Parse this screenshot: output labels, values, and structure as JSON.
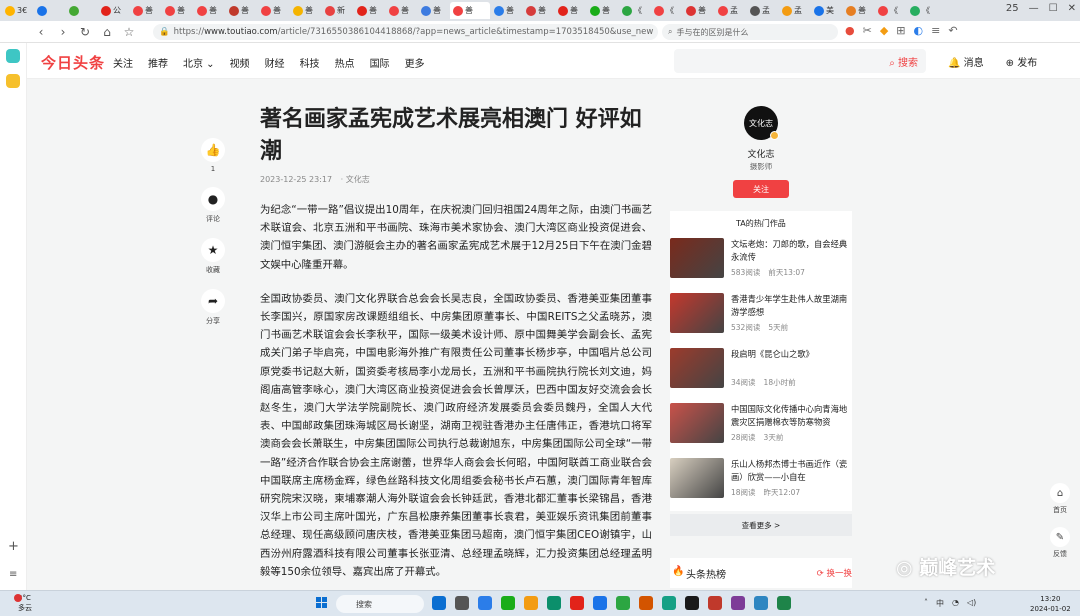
{
  "browser": {
    "tabs": [
      {
        "label": "3€",
        "color": "#ffb400"
      },
      {
        "label": "",
        "color": "#1a73e8"
      },
      {
        "label": "",
        "color": "#44a833"
      },
      {
        "label": "公",
        "color": "#e2231a"
      },
      {
        "label": "善",
        "color": "#f04142"
      },
      {
        "label": "善",
        "color": "#f04142"
      },
      {
        "label": "善",
        "color": "#f04142"
      },
      {
        "label": "善",
        "color": "#c0392b"
      },
      {
        "label": "善",
        "color": "#f04142"
      },
      {
        "label": "善",
        "color": "#f5b400"
      },
      {
        "label": "新",
        "color": "#e84141"
      },
      {
        "label": "善",
        "color": "#e2231a"
      },
      {
        "label": "善",
        "color": "#f04142"
      },
      {
        "label": "善",
        "color": "#3d7be0"
      },
      {
        "label": "善",
        "color": "#f04142",
        "active": true
      },
      {
        "label": "善",
        "color": "#2b7de9"
      },
      {
        "label": "善",
        "color": "#d63b3b"
      },
      {
        "label": "善",
        "color": "#e2231a"
      },
      {
        "label": "善",
        "color": "#1aad19"
      },
      {
        "label": "《",
        "color": "#2ca642"
      },
      {
        "label": "《",
        "color": "#f04142"
      },
      {
        "label": "善",
        "color": "#d33"
      },
      {
        "label": "孟",
        "color": "#f04142"
      },
      {
        "label": "孟",
        "color": "#555"
      },
      {
        "label": "孟",
        "color": "#f39c12"
      },
      {
        "label": "美",
        "color": "#1a73e8"
      },
      {
        "label": "善",
        "color": "#e67e22"
      },
      {
        "label": "《",
        "color": "#f04142"
      },
      {
        "label": "《",
        "color": "#27ae60"
      }
    ],
    "tab_count": "25",
    "url_host": "www.toutiao.com",
    "url_path": "/article/7316550386104418868/?app=news_article&timestamp=1703518450&use_new",
    "search_placeholder": "手与在的区别是什么"
  },
  "site": {
    "logo": "今日头条",
    "nav": [
      "关注",
      "推荐",
      "北京 ⌄",
      "视频",
      "财经",
      "科技",
      "热点",
      "国际",
      "更多"
    ],
    "search_button": "搜索",
    "messages": "消息",
    "publish": "发布"
  },
  "actions": {
    "like_count": "1",
    "comment": "评论",
    "favorite": "收藏",
    "share": "分享"
  },
  "article": {
    "title": "著名画家孟宪成艺术展亮相澳门 好评如潮",
    "date": "2023-12-25 23:17",
    "source": "· 文化志",
    "paragraphs": [
      "为纪念“一带一路”倡议提出10周年，在庆祝澳门回归祖国24周年之际，由澳门书画艺术联谊会、北京五洲和平书画院、珠海市美术家协会、澳门大湾区商业投资促进会、澳门恒宇集团、澳门游艇会主办的著名画家孟宪成艺术展于12月25日下午在澳门金碧文娱中心隆重开幕。",
      "全国政协委员、澳门文化界联合总会会长吴志良，全国政协委员、香港美亚集团董事长李国兴，原国家房改课题组组长、中房集团原董事长、中国REITS之父孟晓苏，澳门书画艺术联谊会会长李秋平，国际一级美术设计师、原中国舞美学会副会长、孟宪成关门弟子毕启亮，中国电影海外推广有限责任公司董事长杨步亭，中国唱片总公司原党委书记赵大新，国资委考核局李小龙局长，五洲和平书画院执行院长刘文迪，妈阁庙高管李咏心，澳门大湾区商业投资促进会会长曾厚沃，巴西中国友好交流会会长赵冬生，澳门大学法学院副院长、澳门政府经济发展委员会委员魏丹，全国人大代表、中国邮政集团珠海城区局长谢坚，湖南卫视驻香港办主任唐伟正，香港坑口将军澳商会会长萧联生，中房集团国际公司执行总裁谢旭东，中房集团国际公司全球“一带一路”经济合作联合协会主席谢蕾，世界华人商会会长何昭，中国阿联酋工商业联合会中国联席主席杨金辉，绿色丝路科技文化周组委会秘书长卢石蕙，澳门国际青年智库研究院宋汉晓，柬埔寨潮人海外联谊会会长钟廷武，香港北都汇董事长梁锦昌，香港汉华上市公司主席叶国光，广东昌松康养集团董事长袁君，美亚娱乐资讯集团前董事总经理、现任高级顾问唐庆枝，香港美亚集团马超南，澳门恒宇集团CEO谢镇宇，山西汾州府露酒科技有限公司董事长张亚清、总经理孟晓辉，汇力投资集团总经理孟明毅等150余位领导、嘉宾出席了开幕式。"
    ]
  },
  "author": {
    "avatar_text": "文化志",
    "name": "文化志",
    "desc": "摄影师",
    "follow": "关注"
  },
  "hot": {
    "title": "TA的热门作品",
    "items": [
      {
        "title": "文坛老炮：刀郎的歌，自会经典永流传",
        "reads": "583阅读",
        "time": "前天13:07",
        "color": "#7a2a1c"
      },
      {
        "title": "香港青少年学生赴伟人故里湖南游学感想",
        "reads": "532阅读",
        "time": "5天前",
        "color": "#c4382d"
      },
      {
        "title": "段启明《昆仑山之歌》",
        "reads": "34阅读",
        "time": "18小时前",
        "color": "#9c3b2c"
      },
      {
        "title": "中国国际文化传播中心向青海地震灾区捐赠棉衣等防寒物资",
        "reads": "28阅读",
        "time": "3天前",
        "color": "#c9524a"
      },
      {
        "title": "乐山人杨邦杰博士书画近作（瓷画）欣赏——小自在",
        "reads": "18阅读",
        "time": "昨天12:07",
        "color": "#d8cfc0"
      }
    ],
    "more": "查看更多 >"
  },
  "hotlist": {
    "title": "头条热榜",
    "refresh": "换一换"
  },
  "float_tools": {
    "home": "首页",
    "feedback": "反馈"
  },
  "watermark": "巅峰艺术",
  "taskbar": {
    "weather_temp": "3°C",
    "weather_desc": "多云",
    "search": "搜索",
    "ime": "中",
    "time": "13:20",
    "date": "2024-01-02"
  }
}
